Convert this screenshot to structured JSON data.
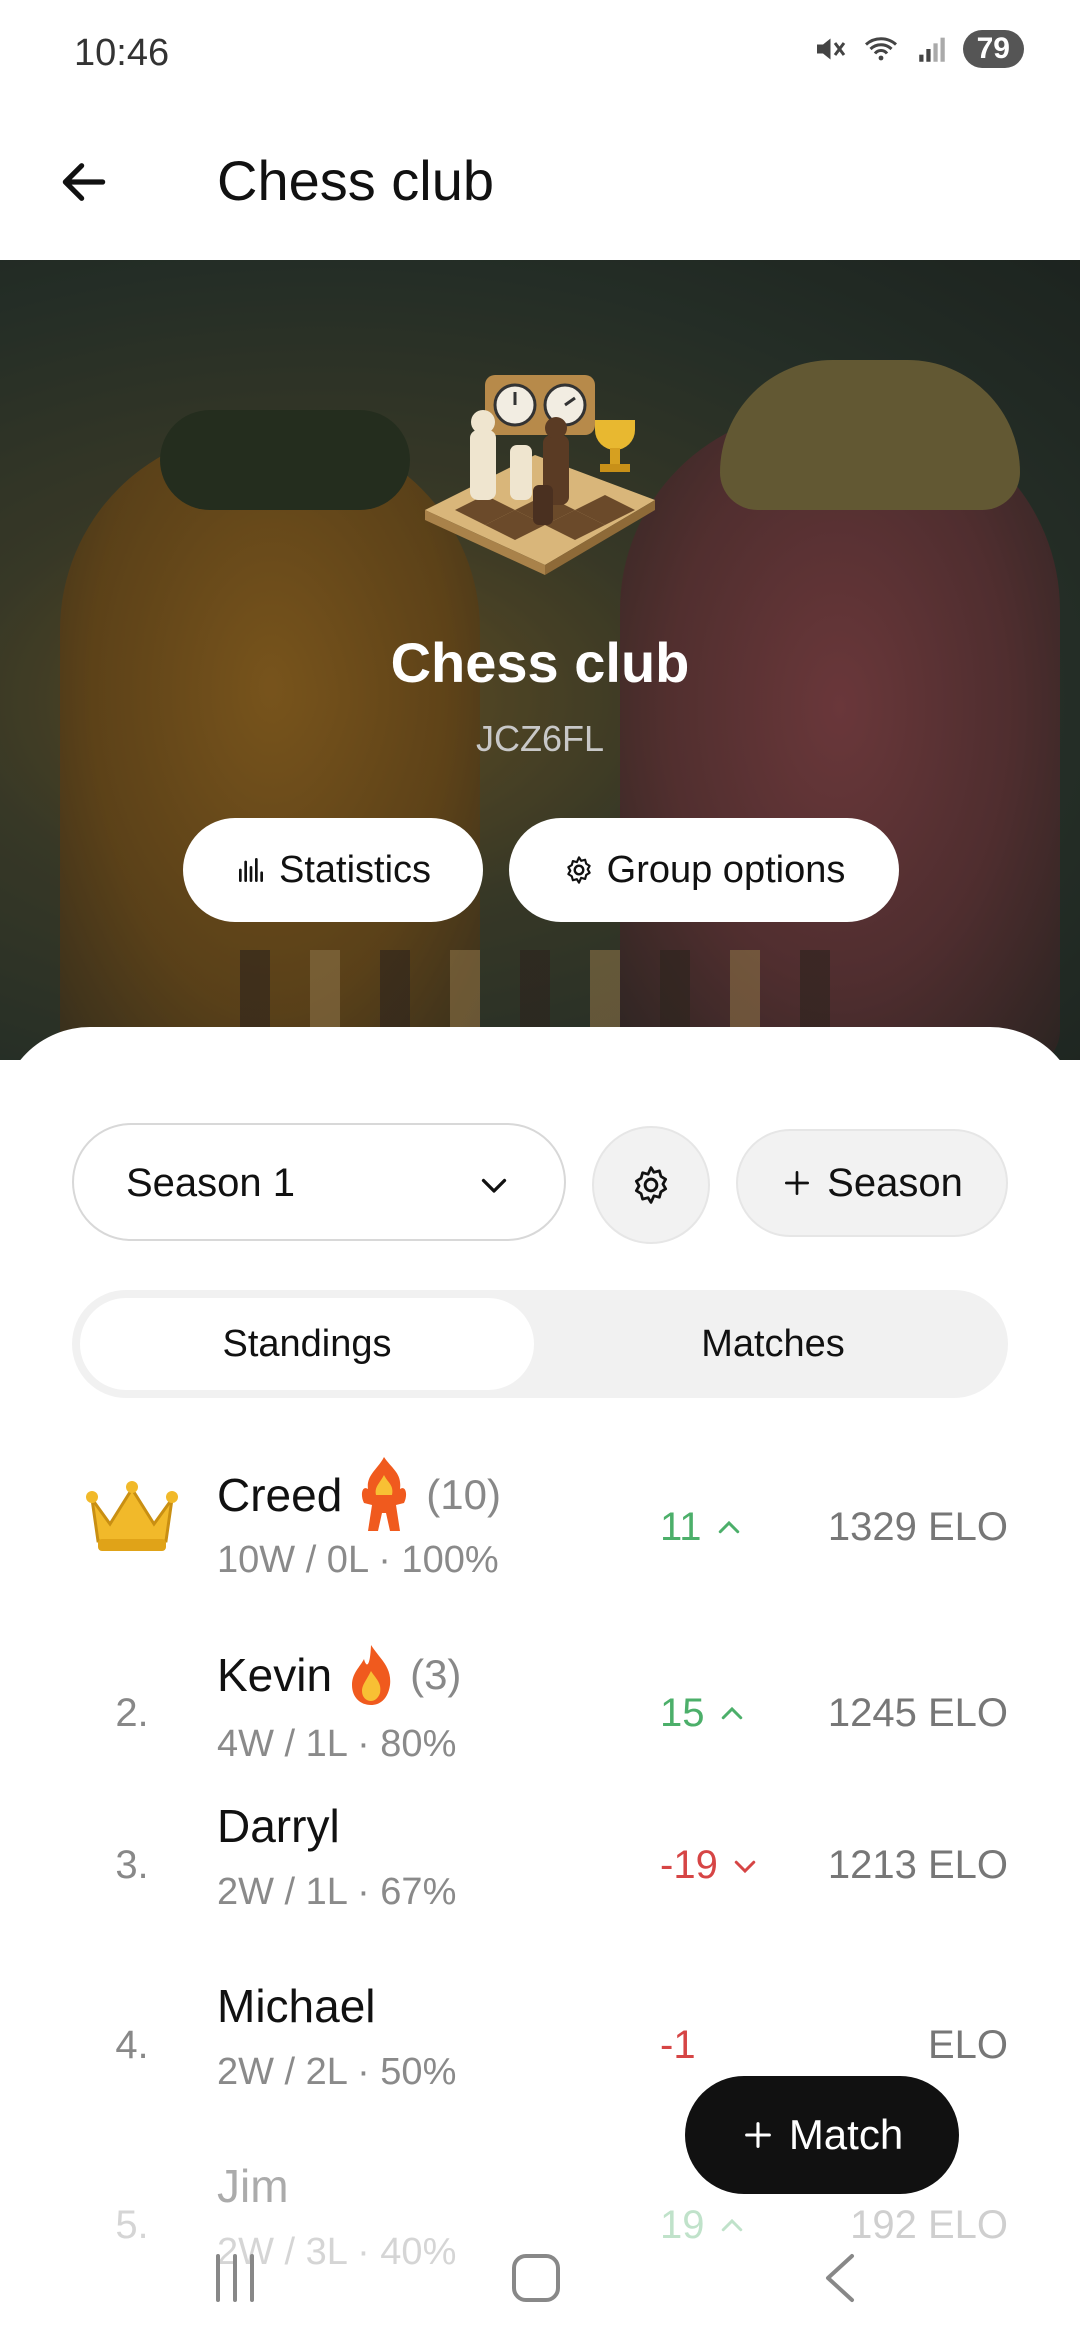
{
  "status_bar": {
    "time": "10:46",
    "battery": "79"
  },
  "app_bar": {
    "title": "Chess club"
  },
  "group": {
    "name": "Chess club",
    "code": "JCZ6FL",
    "statistics_label": "Statistics",
    "options_label": "Group options"
  },
  "season": {
    "selected": "Season 1",
    "add_label": "Season"
  },
  "tabs": {
    "standings": "Standings",
    "matches": "Matches"
  },
  "standings": [
    {
      "rank": "",
      "name": "Creed",
      "streak": "(10)",
      "record": "10W / 0L · 100%",
      "delta": "11",
      "trend": "up",
      "elo": "1329 ELO"
    },
    {
      "rank": "2.",
      "name": "Kevin",
      "streak": "(3)",
      "record": "4W / 1L · 80%",
      "delta": "15",
      "trend": "up",
      "elo": "1245 ELO"
    },
    {
      "rank": "3.",
      "name": "Darryl",
      "streak": "",
      "record": "2W / 1L · 67%",
      "delta": "-19",
      "trend": "down",
      "elo": "1213 ELO"
    },
    {
      "rank": "4.",
      "name": "Michael",
      "streak": "",
      "record": "2W / 2L · 50%",
      "delta": "-1",
      "trend": "down",
      "elo": "ELO"
    },
    {
      "rank": "5.",
      "name": "Jim",
      "streak": "",
      "record": "2W / 3L · 40%",
      "delta": "19",
      "trend": "up",
      "elo": "192 ELO"
    }
  ],
  "fab": {
    "label": "Match"
  },
  "colors": {
    "up": "#4caf6a",
    "down": "#d64545",
    "fab": "#111111"
  }
}
